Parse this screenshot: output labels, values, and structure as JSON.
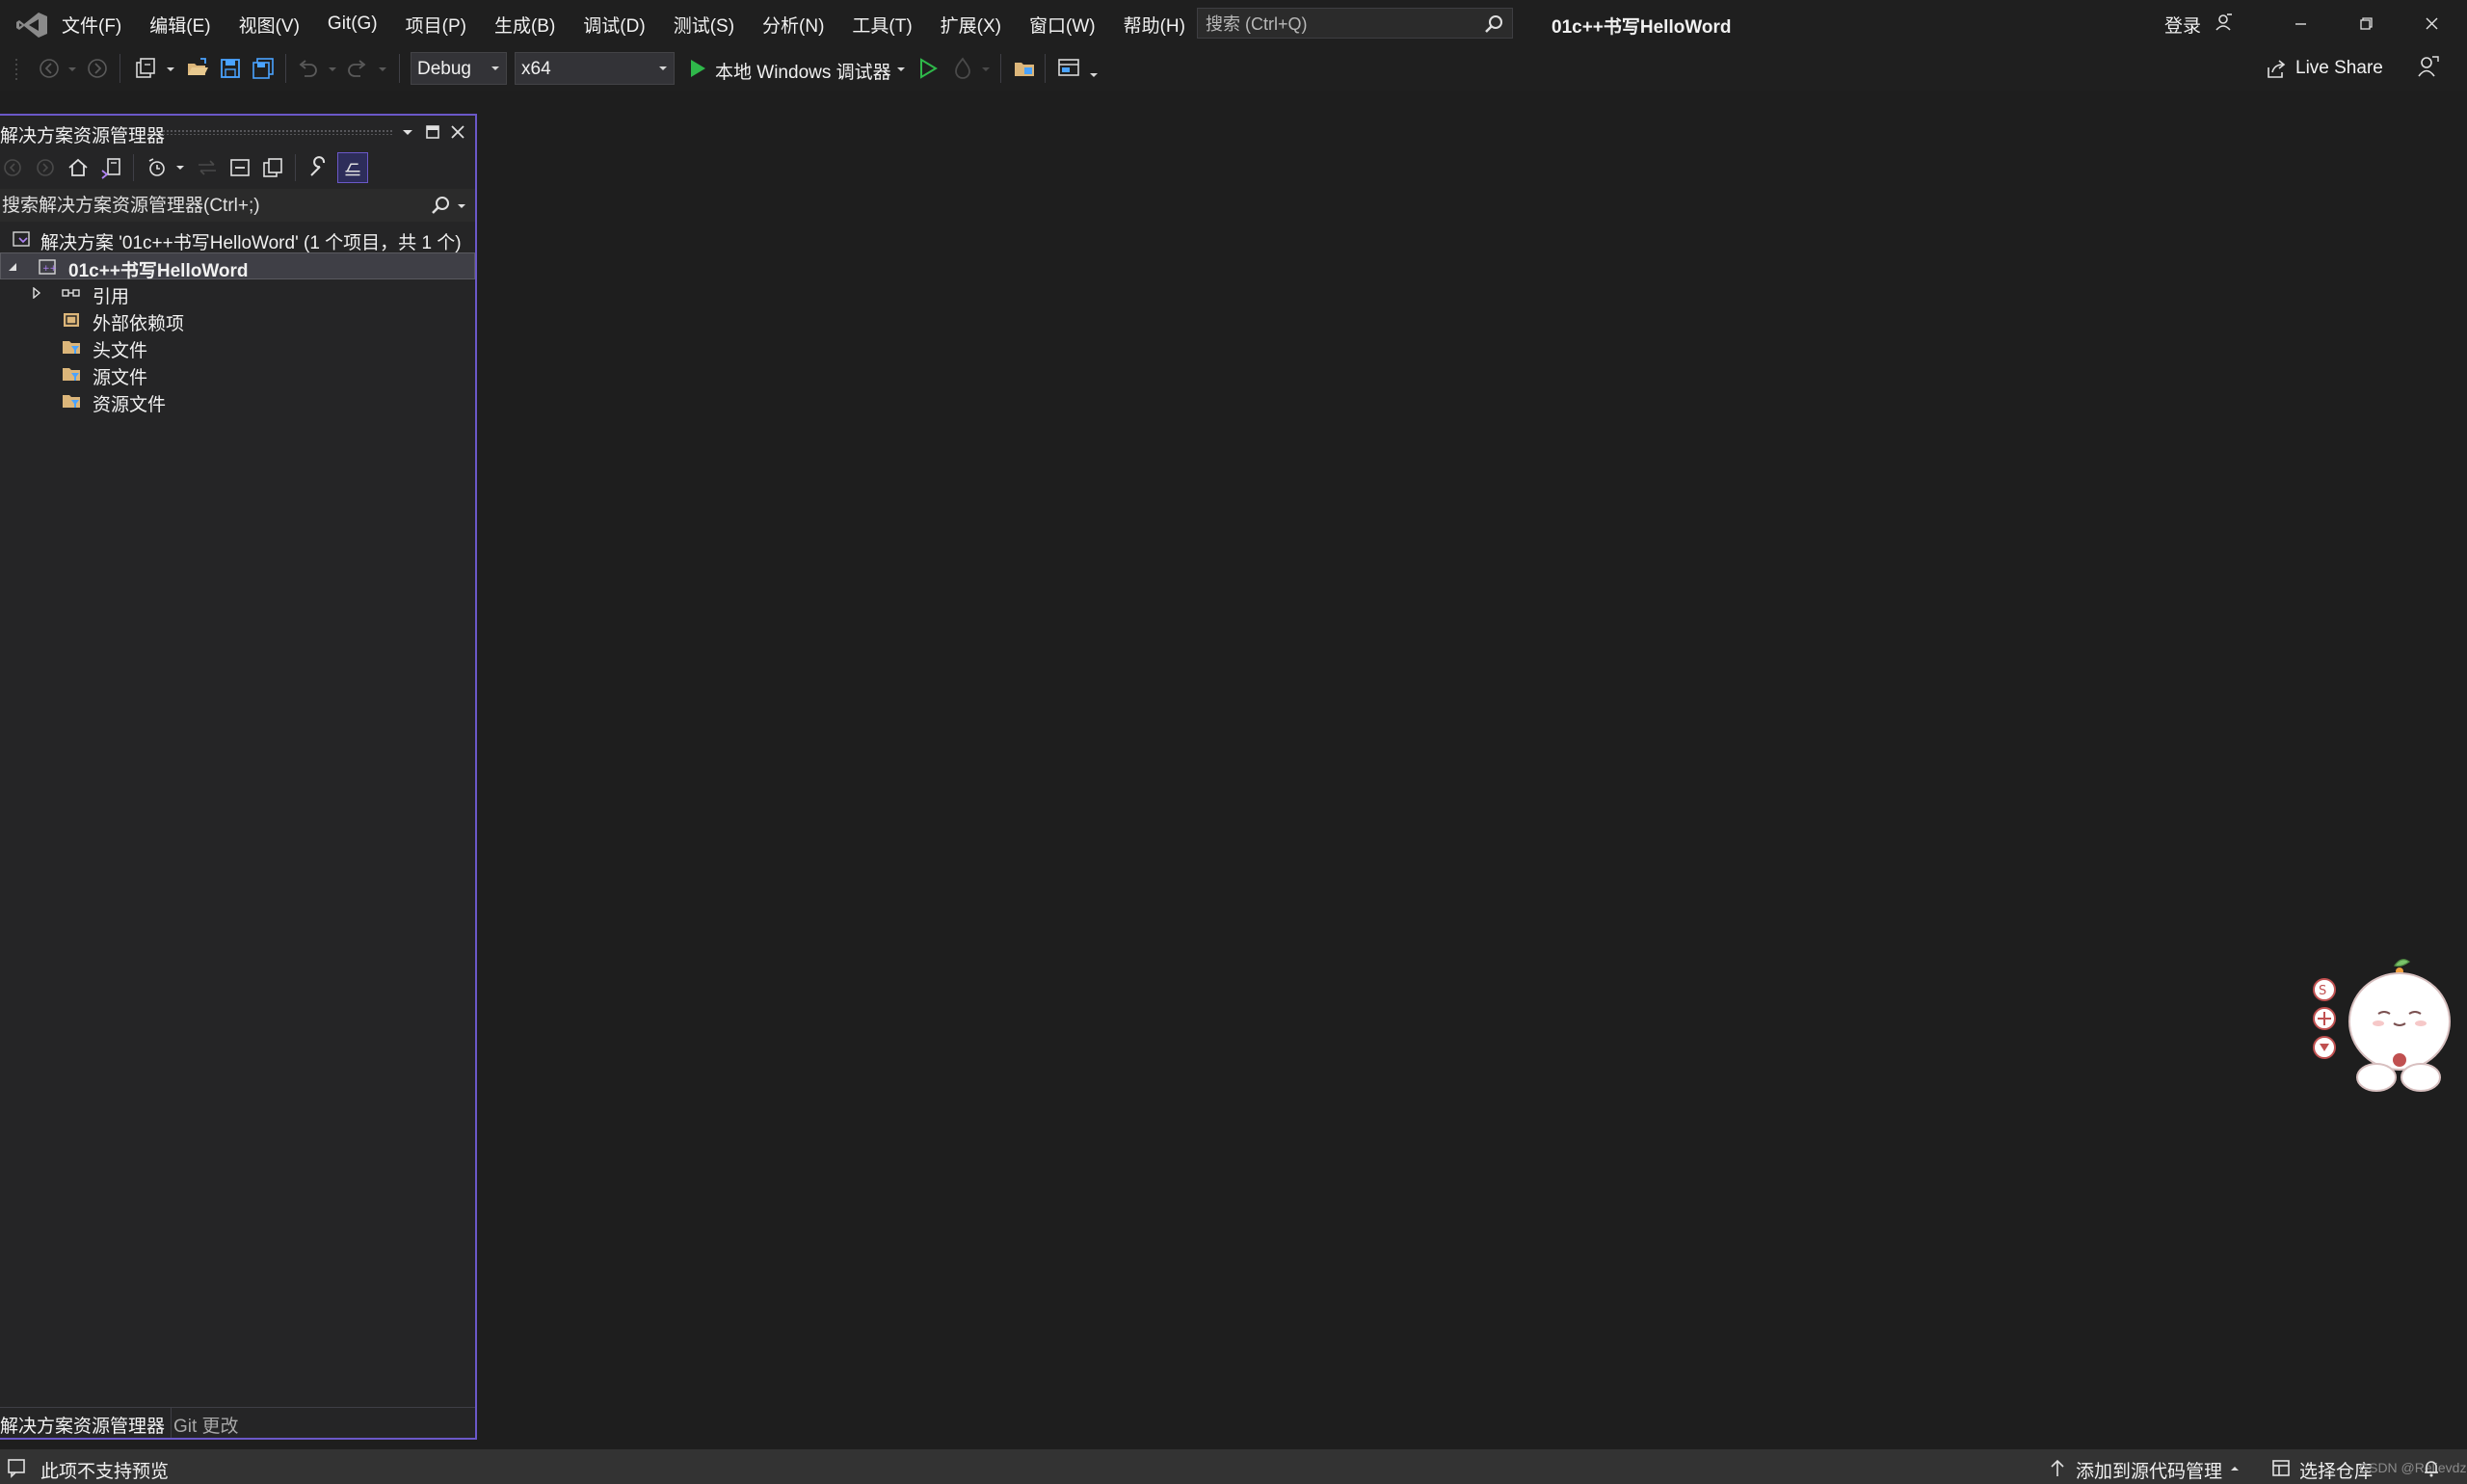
{
  "menu": {
    "items": [
      "文件(F)",
      "编辑(E)",
      "视图(V)",
      "Git(G)",
      "项目(P)",
      "生成(B)",
      "调试(D)",
      "测试(S)",
      "分析(N)",
      "工具(T)",
      "扩展(X)",
      "窗口(W)",
      "帮助(H)"
    ]
  },
  "search": {
    "placeholder": "搜索 (Ctrl+Q)"
  },
  "window": {
    "title": "01c++书写HelloWord",
    "signin": "登录"
  },
  "toolbar": {
    "config": "Debug",
    "platform": "x64",
    "run_label": "本地 Windows 调试器",
    "liveshare": "Live Share"
  },
  "panel": {
    "title": "解决方案资源管理器",
    "search_placeholder": "搜索解决方案资源管理器(Ctrl+;)",
    "tree": {
      "solution": "解决方案 '01c++书写HelloWord' (1 个项目，共 1 个)",
      "project": "01c++书写HelloWord",
      "references": "引用",
      "external": "外部依赖项",
      "headers": "头文件",
      "sources": "源文件",
      "resources": "资源文件"
    },
    "tabs": {
      "solution": "解决方案资源管理器",
      "git": "Git 更改"
    }
  },
  "statusbar": {
    "text": "此项不支持预览",
    "add_source": "添加到源代码管理",
    "select_repo": "选择仓库",
    "watermark": "CSDN @Relievdz"
  },
  "colors": {
    "background": "#1e1e1e",
    "chrome": "#1f1f1f",
    "panel": "#252526",
    "accent": "#6b58c8",
    "run_green": "#2fb84a",
    "statusbar": "#333333"
  }
}
